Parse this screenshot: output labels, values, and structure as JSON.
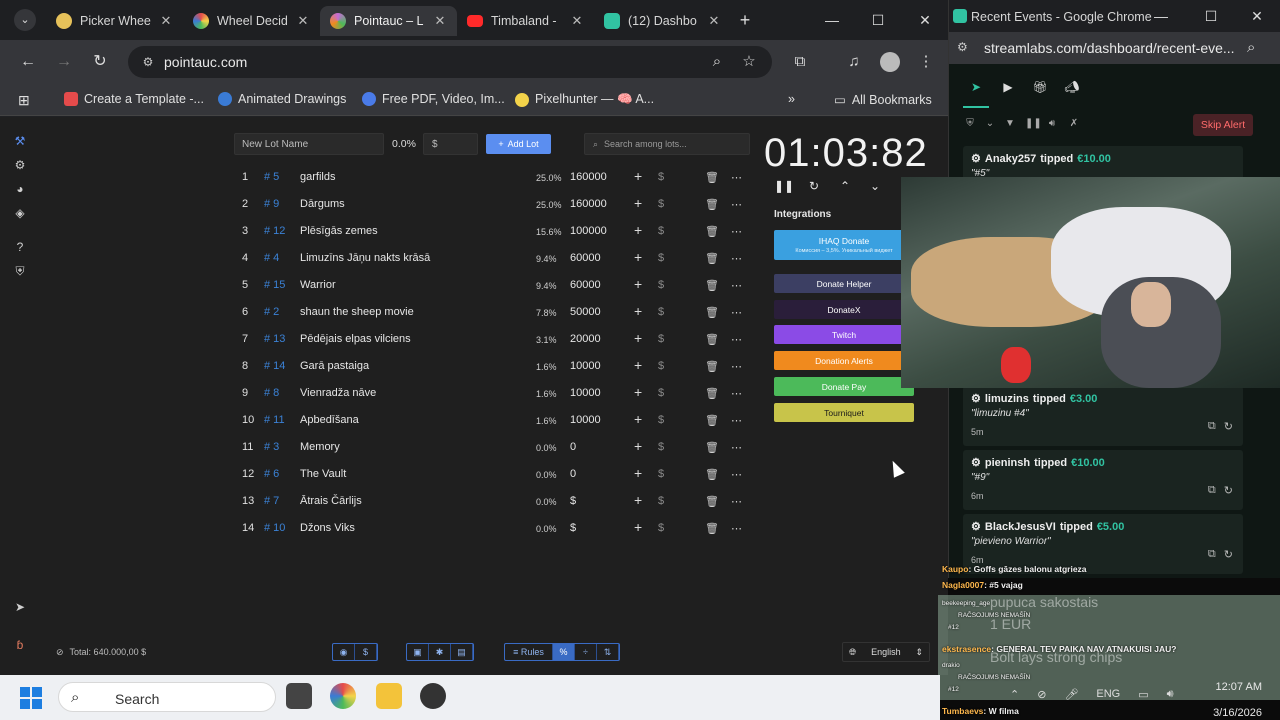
{
  "main_window": {
    "tabs": [
      {
        "title": "Picker Whee",
        "color": "#e6c15a"
      },
      {
        "title": "Wheel Decid",
        "color": "#d94c6e"
      },
      {
        "title": "Pointauc – L",
        "color": "#c46bd6"
      },
      {
        "title": "Timbaland -",
        "color": "#ff2a2a"
      },
      {
        "title": "(12) Dashbo",
        "color": "#31c3a2"
      }
    ],
    "url": "pointauc.com",
    "bookmarks": [
      {
        "label": "Create a Template -...",
        "color": "#e54b4b"
      },
      {
        "label": "Animated Drawings",
        "color": "#3a7bd5"
      },
      {
        "label": "Free PDF, Video, Im...",
        "color": "#4a7be8"
      },
      {
        "label": "Pixelhunter — 🧠 A...",
        "color": "#f3d34a"
      }
    ],
    "all_bookmarks": "All Bookmarks"
  },
  "auction": {
    "new_lot_placeholder": "New Lot Name",
    "new_lot_pct": "0.0%",
    "amount_placeholder": "$",
    "add_lot": "Add Lot",
    "search_placeholder": "Search among lots...",
    "lots": [
      {
        "idx": "1",
        "id": "# 5",
        "name": "garfilds",
        "pct": "25.0%",
        "amount": "160000"
      },
      {
        "idx": "2",
        "id": "# 9",
        "name": "Dārgums",
        "pct": "25.0%",
        "amount": "160000"
      },
      {
        "idx": "3",
        "id": "# 12",
        "name": "Plēsīgās zemes",
        "pct": "15.6%",
        "amount": "100000"
      },
      {
        "idx": "4",
        "id": "# 4",
        "name": "Limuzīns Jāņu nakts krāsā",
        "pct": "9.4%",
        "amount": "60000"
      },
      {
        "idx": "5",
        "id": "# 15",
        "name": "Warrior",
        "pct": "9.4%",
        "amount": "60000"
      },
      {
        "idx": "6",
        "id": "# 2",
        "name": "shaun the sheep movie",
        "pct": "7.8%",
        "amount": "50000"
      },
      {
        "idx": "7",
        "id": "# 13",
        "name": "Pēdējais elpas vilciens",
        "pct": "3.1%",
        "amount": "20000"
      },
      {
        "idx": "8",
        "id": "# 14",
        "name": "Garā pastaiga",
        "pct": "1.6%",
        "amount": "10000"
      },
      {
        "idx": "9",
        "id": "# 8",
        "name": "Vienradža nāve",
        "pct": "1.6%",
        "amount": "10000"
      },
      {
        "idx": "10",
        "id": "# 11",
        "name": "Apbedīšana",
        "pct": "1.6%",
        "amount": "10000"
      },
      {
        "idx": "11",
        "id": "# 3",
        "name": "Memory",
        "pct": "0.0%",
        "amount": "0"
      },
      {
        "idx": "12",
        "id": "# 6",
        "name": "The Vault",
        "pct": "0.0%",
        "amount": "0"
      },
      {
        "idx": "13",
        "id": "# 7",
        "name": "Ātrais Čārlijs",
        "pct": "0.0%",
        "amount": "$"
      },
      {
        "idx": "14",
        "id": "# 10",
        "name": "Džons Viks",
        "pct": "0.0%",
        "amount": "$"
      }
    ],
    "timer": "01:03:82",
    "integrations_title": "Integrations",
    "integrations": [
      {
        "label": "IHAQ Donate",
        "sub": "Комиссия – 3,5%. Уникальный виджет",
        "color": "#3aa0e0"
      },
      {
        "label": "Donate Helper",
        "sub": "",
        "color": "#3c3f63"
      },
      {
        "label": "DonateX",
        "sub": "",
        "color": "#2a1e3a"
      },
      {
        "label": "Twitch",
        "sub": "",
        "color": "#8b4be6"
      },
      {
        "label": "Donation Alerts",
        "sub": "",
        "color": "#f08a1e"
      },
      {
        "label": "Donate Pay",
        "sub": "",
        "color": "#4cba5a"
      },
      {
        "label": "Tourniquet",
        "sub": "",
        "color": "#c8c44a"
      }
    ],
    "total": "Total: 640.000,00 $",
    "rules": "Rules",
    "language": "English"
  },
  "streamlabs": {
    "window_title": "Recent Events - Google Chrome",
    "url": "streamlabs.com/dashboard/recent-eve...",
    "skip_alert": "Skip Alert",
    "events": [
      {
        "user": "Anaky257",
        "verb": "tipped",
        "amount": "€10.00",
        "message": "\"#5\"",
        "time": ""
      },
      {
        "user": "limuzins",
        "verb": "tipped",
        "amount": "€3.00",
        "message": "\"limuzinu #4\"",
        "time": "5m"
      },
      {
        "user": "pieninsh",
        "verb": "tipped",
        "amount": "€10.00",
        "message": "\"#9\"",
        "time": "6m"
      },
      {
        "user": "BlackJesusVI",
        "verb": "tipped",
        "amount": "€5.00",
        "message": "\"pievieno Warrior\"",
        "time": "6m"
      }
    ]
  },
  "chat": [
    {
      "nick": "Kaupo",
      "text": ": Goffs gāzes balonu atgrieza"
    },
    {
      "nick": "Nagla0007",
      "text": ": #5 vajag"
    },
    {
      "nick": "beekeeping_age",
      "text": ""
    },
    {
      "nick": "",
      "text": "RAČSOJUMS NEMAŠĪN"
    },
    {
      "nick": "",
      "text": "#12"
    },
    {
      "nick": "ekstrasence",
      "text": ": GENERAL TEV PAIKA NAV ATNAKUISI JAU?"
    },
    {
      "nick": "drakio",
      "text": ""
    },
    {
      "nick": "",
      "text": "RAČSOJUMS NEMAŠĪN"
    },
    {
      "nick": "",
      "text": "#12"
    },
    {
      "nick": "Tumbaevs",
      "text": ": W filma"
    }
  ],
  "chat_ghosts": [
    "pupuca sakostais",
    "1 EUR",
    "Bolt lays strong chips"
  ],
  "taskbar": {
    "search": "Search",
    "time": "12:07 AM",
    "date": "3/16/2026",
    "lang": "ENG"
  }
}
